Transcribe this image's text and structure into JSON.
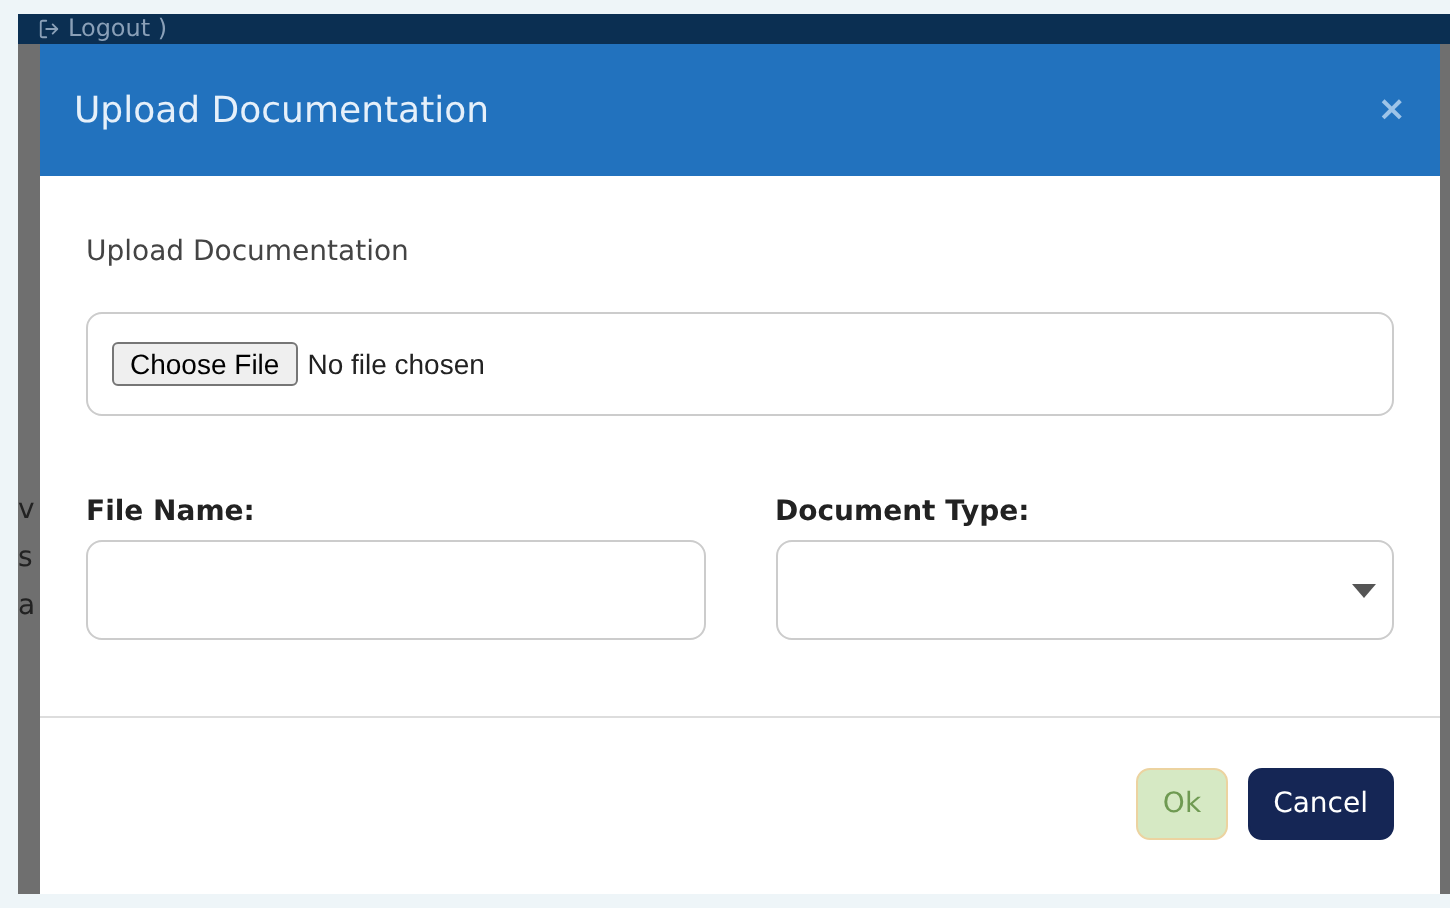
{
  "background": {
    "nav_link": "Logout )",
    "fragments": [
      "v",
      "s",
      "a"
    ]
  },
  "dialog": {
    "title": "Upload Documentation",
    "close": "×",
    "section_label": "Upload Documentation",
    "file_input": {
      "button": "Choose File",
      "status": "No file chosen"
    },
    "fields": [
      {
        "kind": "text",
        "label": "File Name:"
      },
      {
        "kind": "select",
        "label": "Document Type:"
      }
    ],
    "buttons": [
      {
        "label": "Ok",
        "kind": "primary",
        "disabled": true
      },
      {
        "label": "Cancel",
        "kind": "secondary",
        "disabled": false
      }
    ]
  }
}
